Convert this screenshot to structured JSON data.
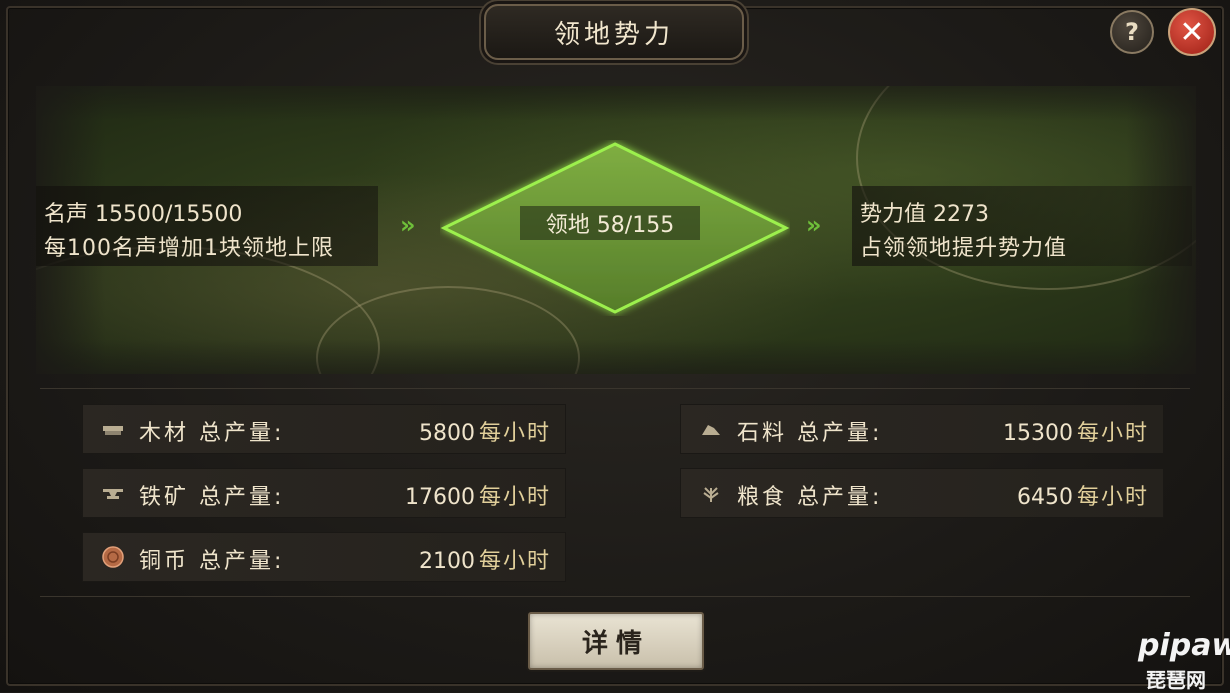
{
  "header": {
    "title": "领地势力",
    "help_label": "?",
    "close_label": "✕"
  },
  "banner": {
    "reputation_line": "名声 15500/15500",
    "reputation_desc": "每100名声增加1块领地上限",
    "territory_label": "领地 58/155",
    "power_line": "势力值 2273",
    "power_desc": "占领领地提升势力值",
    "arrow_glyph": "»"
  },
  "resources": [
    {
      "name": "木材 总产量:",
      "value": "5800",
      "unit": "每小时",
      "icon": "wood-icon"
    },
    {
      "name": "石料 总产量:",
      "value": "15300",
      "unit": "每小时",
      "icon": "stone-icon"
    },
    {
      "name": "铁矿 总产量:",
      "value": "17600",
      "unit": "每小时",
      "icon": "iron-anvil-icon"
    },
    {
      "name": "粮食 总产量:",
      "value": "6450",
      "unit": "每小时",
      "icon": "grain-icon"
    },
    {
      "name": "铜币 总产量:",
      "value": "2100",
      "unit": "每小时",
      "icon": "copper-coin-icon"
    }
  ],
  "footer": {
    "detail_label": "详情"
  },
  "watermark": {
    "logo": "pipaw",
    "text": "琵琶网"
  },
  "colors": {
    "accent_green": "#7cd13f",
    "close_red": "#c23224",
    "unit_gold": "#e1cf9a"
  }
}
